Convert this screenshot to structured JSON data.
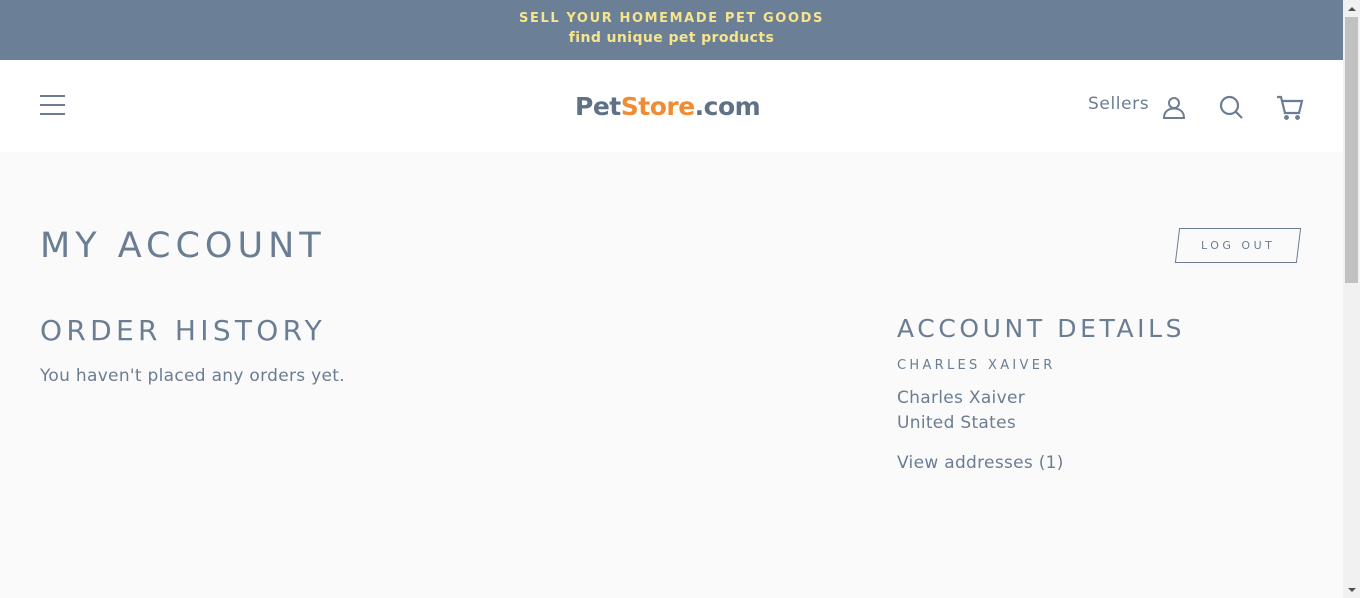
{
  "announcement": {
    "line1": "SELL YOUR HOMEMADE PET GOODS",
    "line2": "find unique pet products"
  },
  "header": {
    "logo": {
      "part1": "Pet",
      "part2": "Store",
      "part3": ".com"
    },
    "sellers_label": "Sellers",
    "icons": [
      "hamburger-menu-icon",
      "account-icon",
      "search-icon",
      "cart-icon"
    ]
  },
  "main": {
    "page_title": "MY ACCOUNT",
    "logout_label": "LOG OUT",
    "order_history": {
      "title": "ORDER HISTORY",
      "empty_message": "You haven't placed any orders yet."
    },
    "account_details": {
      "title": "ACCOUNT DETAILS",
      "name_caps": "CHARLES XAIVER",
      "name": "Charles Xaiver",
      "country": "United States",
      "view_addresses": "View addresses (1)"
    }
  },
  "colors": {
    "announcement_bg": "#6b7f96",
    "announcement_text": "#f7e58e",
    "text": "#6b7d92",
    "logo_accent": "#f08c33",
    "page_bg": "#fafafb"
  }
}
